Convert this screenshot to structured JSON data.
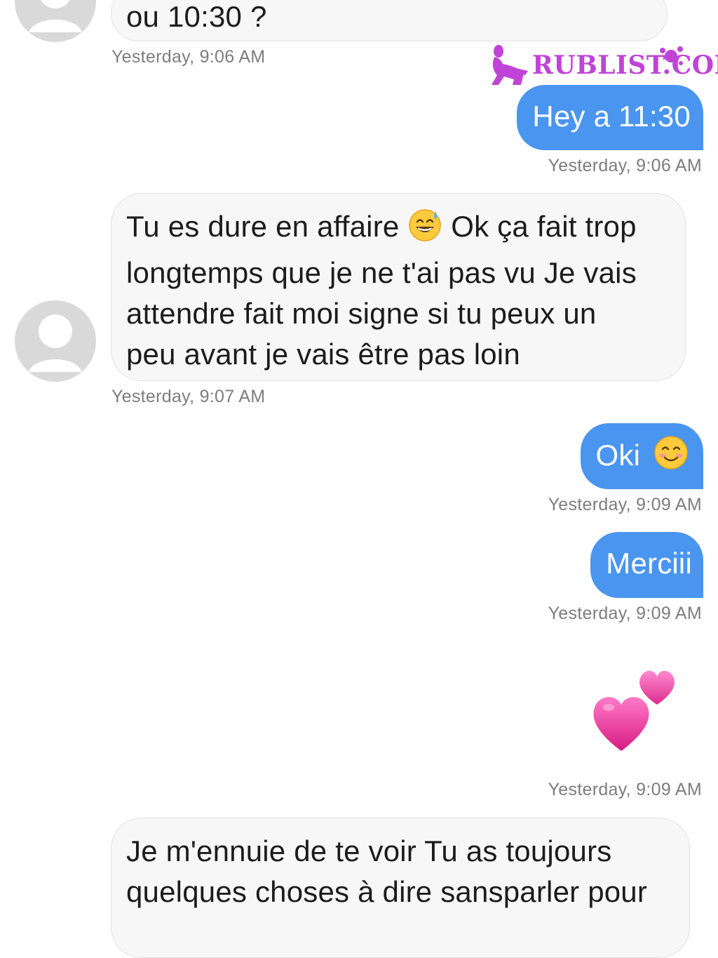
{
  "watermark": {
    "text": "RUBLIST.COM",
    "color": "#c043d8"
  },
  "messages": [
    {
      "direction": "incoming",
      "text": "ou 10:30 ?",
      "timestamp": "Yesterday, 9:06 AM"
    },
    {
      "direction": "outgoing",
      "text": "Hey a 11:30",
      "timestamp": "Yesterday, 9:06 AM"
    },
    {
      "direction": "incoming",
      "text_before_emoji": "Tu es dure en affaire",
      "emoji": "grinning-sweat-emoji",
      "text_after_emoji": "Ok ça fait trop",
      "lines": [
        "longtemps que je ne t'ai pas vu Je vais",
        "attendre fait moi signe si tu peux un",
        "peu avant je vais être pas loin"
      ],
      "timestamp": "Yesterday, 9:07 AM"
    },
    {
      "direction": "outgoing",
      "text": "Oki",
      "emoji": "smiling-face-emoji",
      "timestamp": "Yesterday, 9:09 AM"
    },
    {
      "direction": "outgoing",
      "text": "Merciii",
      "timestamp": "Yesterday, 9:09 AM"
    },
    {
      "direction": "outgoing",
      "emoji": "two-hearts-emoji",
      "timestamp": "Yesterday, 9:09 AM"
    },
    {
      "direction": "incoming",
      "lines": [
        "Je m'ennuie de te voir Tu as toujours",
        "quelques choses à dire sansparler pour"
      ]
    }
  ],
  "colors": {
    "outgoing_bubble": "#4a95ef",
    "incoming_bubble": "#f7f7f7",
    "timestamp": "#7d7d7d",
    "avatar": "#d9d9d9",
    "heart": "#e8459e"
  }
}
